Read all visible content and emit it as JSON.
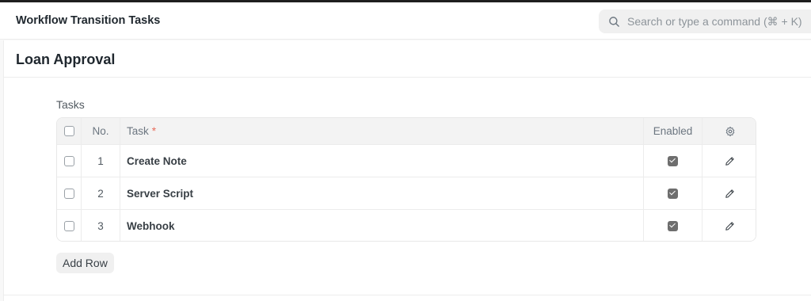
{
  "navbar": {
    "title": "Workflow Transition Tasks",
    "search_placeholder": "Search or type a command (⌘ + K)"
  },
  "page": {
    "title": "Loan Approval"
  },
  "tasks_section": {
    "label": "Tasks",
    "columns": {
      "no": "No.",
      "task": "Task",
      "required_marker": "*",
      "enabled": "Enabled"
    },
    "rows": [
      {
        "no": "1",
        "task": "Create Note",
        "enabled": true
      },
      {
        "no": "2",
        "task": "Server Script",
        "enabled": true
      },
      {
        "no": "3",
        "task": "Webhook",
        "enabled": true
      }
    ],
    "add_row_label": "Add Row"
  },
  "icons": {
    "search": "search-icon",
    "settings": "gear-icon",
    "edit": "pencil-icon"
  }
}
